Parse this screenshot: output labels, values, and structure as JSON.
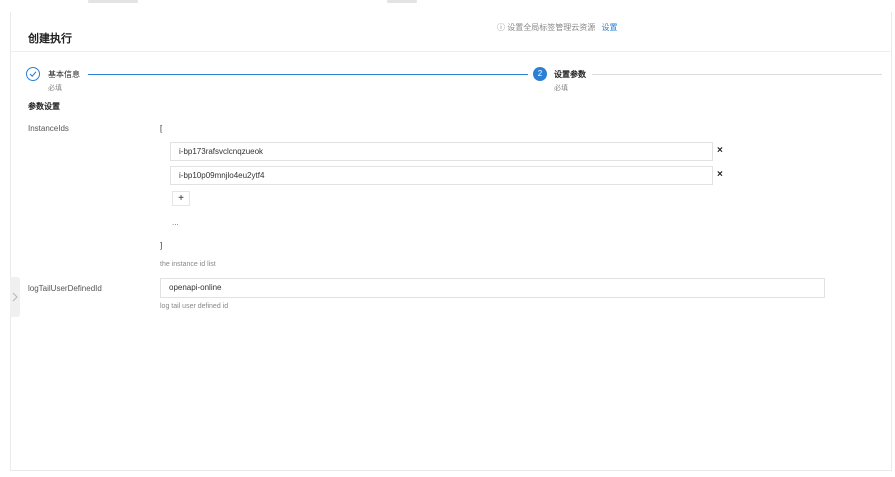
{
  "hint": {
    "text": "设置全局标签管理云资源",
    "link": "设置"
  },
  "page_title": "创建执行",
  "steps": [
    {
      "title": "基本信息",
      "sub": "必填",
      "status": "done"
    },
    {
      "number": "2",
      "title": "设置参数",
      "sub": "必填",
      "status": "active"
    }
  ],
  "section_title": "参数设置",
  "params": {
    "instanceIds": {
      "label": "InstanceIds",
      "open_bracket": "[",
      "items": [
        "i-bp173rafsvclcnqzueok",
        "i-bp10p09mnjlo4eu2ytf4"
      ],
      "add_label": "+",
      "ellipsis": "...",
      "close_bracket": "]",
      "help": "the instance id list"
    },
    "logTail": {
      "label": "logTailUserDefinedId",
      "value": "openapi-online",
      "help": "log tail user defined id"
    }
  },
  "icons": {
    "delete": "×",
    "info": "ⓘ"
  },
  "colors": {
    "accent": "#2b7fd4"
  }
}
